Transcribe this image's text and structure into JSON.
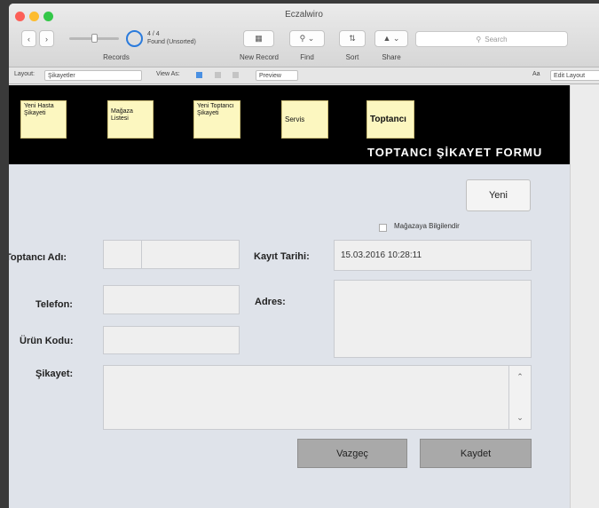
{
  "window": {
    "title": "Eczalwiro",
    "toolbar": {
      "record_label": "Records",
      "record_status_line1": "4 / 4",
      "record_status_line2": "Found (Unsorted)",
      "new_record_label": "New Record",
      "find_label": "Find",
      "sort_label": "Sort",
      "share_label": "Share",
      "search_placeholder": "Search"
    },
    "format_bar": {
      "layout_label": "Layout:",
      "layout_value": "Şikayetler",
      "view_as_label": "View As:",
      "preview_button": "Preview",
      "aa_label": "Aa",
      "edit_layout": "Edit Layout"
    }
  },
  "nav": [
    {
      "label": "Yeni Hasta Şikayeti"
    },
    {
      "label": "Mağaza Listesi"
    },
    {
      "label": "Yeni Toptancı Şikayeti"
    },
    {
      "label": "Servis"
    },
    {
      "label": "Toptancı"
    }
  ],
  "form": {
    "title": "TOPTANCI ŞİKAYET FORMU",
    "new_button": "Yeni",
    "checkbox_label": "Mağazaya Bilgilendir",
    "fields": {
      "toptanci_adi_label": "Toptancı Adı:",
      "toptanci_adi_value": "",
      "kayit_tarihi_label": "Kayıt Tarihi:",
      "kayit_tarihi_value": "15.03.2016 10:28:11",
      "telefon_label": "Telefon:",
      "telefon_value": "",
      "adres_label": "Adres:",
      "adres_value": "",
      "urun_kodu_label": "Ürün Kodu:",
      "urun_kodu_value": "",
      "sikayet_label": "Şikayet:",
      "sikayet_value": ""
    },
    "cancel_button": "Vazgeç",
    "save_button": "Kaydet"
  }
}
